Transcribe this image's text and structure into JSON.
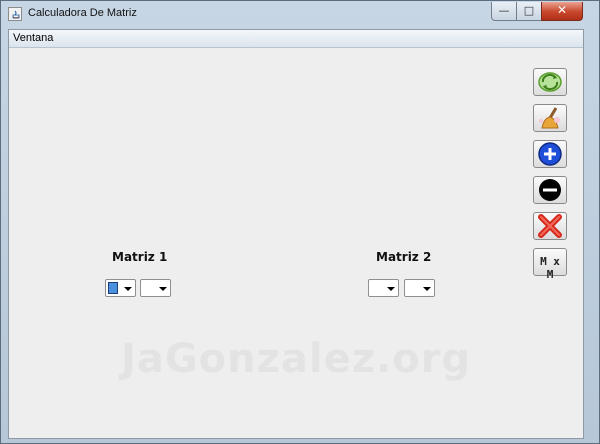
{
  "window": {
    "title": "Calculadora De Matriz"
  },
  "menubar": {
    "items": [
      {
        "label": "Ventana"
      }
    ]
  },
  "matrix1": {
    "label": "Matriz 1"
  },
  "matrix2": {
    "label": "Matriz 2"
  },
  "toolbar": {
    "buttons": [
      {
        "name": "refresh-button",
        "icon": "refresh-icon"
      },
      {
        "name": "clear-button",
        "icon": "broom-icon"
      },
      {
        "name": "add-button",
        "icon": "plus-circle-icon"
      },
      {
        "name": "subtract-button",
        "icon": "minus-circle-icon"
      },
      {
        "name": "close-matrix-button",
        "icon": "x-icon"
      },
      {
        "name": "multiply-button",
        "label": "M x M"
      }
    ]
  },
  "watermark": "JaGonzalez.org",
  "colors": {
    "accent_blue": "#1f4ed8",
    "close_red": "#c8462c",
    "refresh_green": "#6bbf3a"
  }
}
